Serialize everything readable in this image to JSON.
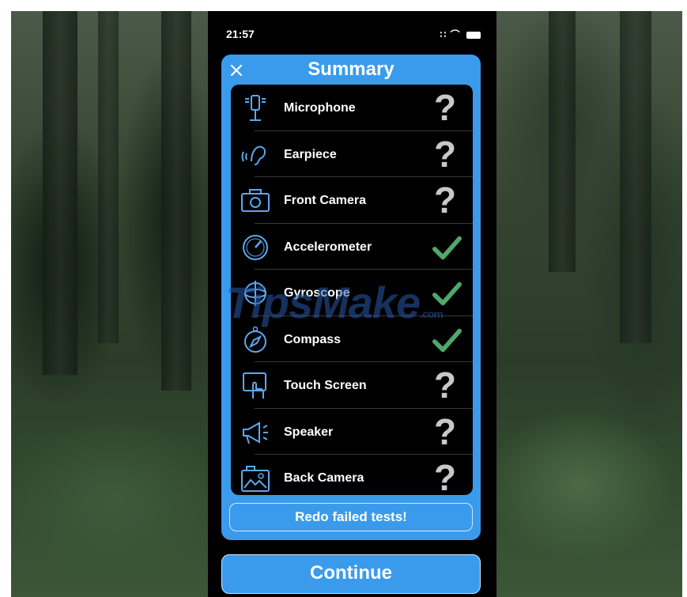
{
  "status_bar": {
    "time": "21:57",
    "signal": "∷",
    "wifi": "⌒"
  },
  "summary": {
    "title": "Summary",
    "close_icon": "close-icon",
    "items": [
      {
        "label": "Microphone",
        "icon": "microphone-icon",
        "status": "untested",
        "status_text": "?"
      },
      {
        "label": "Earpiece",
        "icon": "ear-icon",
        "status": "untested",
        "status_text": "?"
      },
      {
        "label": "Front Camera",
        "icon": "camera-icon",
        "status": "untested",
        "status_text": "?"
      },
      {
        "label": "Accelerometer",
        "icon": "gauge-icon",
        "status": "passed",
        "status_text": ""
      },
      {
        "label": "Gyroscope",
        "icon": "gyroscope-icon",
        "status": "passed",
        "status_text": ""
      },
      {
        "label": "Compass",
        "icon": "compass-icon",
        "status": "passed",
        "status_text": ""
      },
      {
        "label": "Touch Screen",
        "icon": "touch-screen-icon",
        "status": "untested",
        "status_text": "?"
      },
      {
        "label": "Speaker",
        "icon": "megaphone-icon",
        "status": "untested",
        "status_text": "?"
      },
      {
        "label": "Back Camera",
        "icon": "photo-camera-icon",
        "status": "untested",
        "status_text": "?"
      }
    ],
    "redo_label": "Redo failed tests!"
  },
  "continue_label": "Continue",
  "watermark": {
    "text": "TipsMake",
    "suffix": ".com"
  },
  "colors": {
    "accent": "#3a9bec",
    "pass": "#4fa86a",
    "unknown": "#c8c8c8",
    "icon": "#5aa9ef"
  }
}
